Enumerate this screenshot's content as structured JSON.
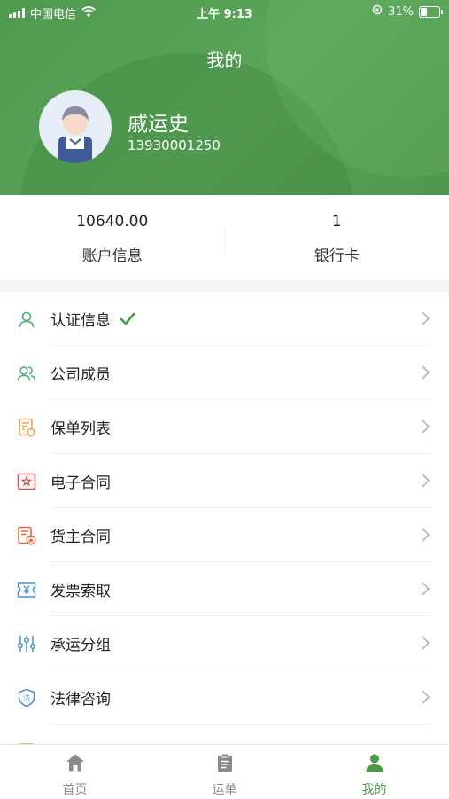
{
  "status_bar": {
    "carrier": "中国电信",
    "time": "上午 9:13",
    "battery_percent": "31%"
  },
  "header": {
    "title": "我的",
    "user_name": "戚运史",
    "phone": "13930001250"
  },
  "stats": [
    {
      "value": "10640.00",
      "label": "账户信息"
    },
    {
      "value": "1",
      "label": "银行卡"
    }
  ],
  "menu": [
    {
      "label": "认证信息",
      "icon": "user-outline-icon",
      "verified": true
    },
    {
      "label": "公司成员",
      "icon": "users-icon"
    },
    {
      "label": "保单列表",
      "icon": "policy-document-icon"
    },
    {
      "label": "电子合同",
      "icon": "e-contract-stamp-icon"
    },
    {
      "label": "货主合同",
      "icon": "shipper-contract-icon"
    },
    {
      "label": "发票索取",
      "icon": "invoice-yen-icon"
    },
    {
      "label": "承运分组",
      "icon": "sliders-icon"
    },
    {
      "label": "法律咨询",
      "icon": "law-shield-icon"
    }
  ],
  "tabs": [
    {
      "label": "首页",
      "icon": "home-icon",
      "active": false
    },
    {
      "label": "运单",
      "icon": "waybill-clipboard-icon",
      "active": false
    },
    {
      "label": "我的",
      "icon": "profile-icon",
      "active": true
    }
  ],
  "colors": {
    "brand_green": "#4f9a4f",
    "tab_active": "#4a9a4a",
    "tab_inactive": "#8a8a8a",
    "icon_green": "#4caf75",
    "icon_orange": "#f0a050",
    "icon_red": "#e24c4c",
    "icon_blue": "#4a8fd6"
  }
}
